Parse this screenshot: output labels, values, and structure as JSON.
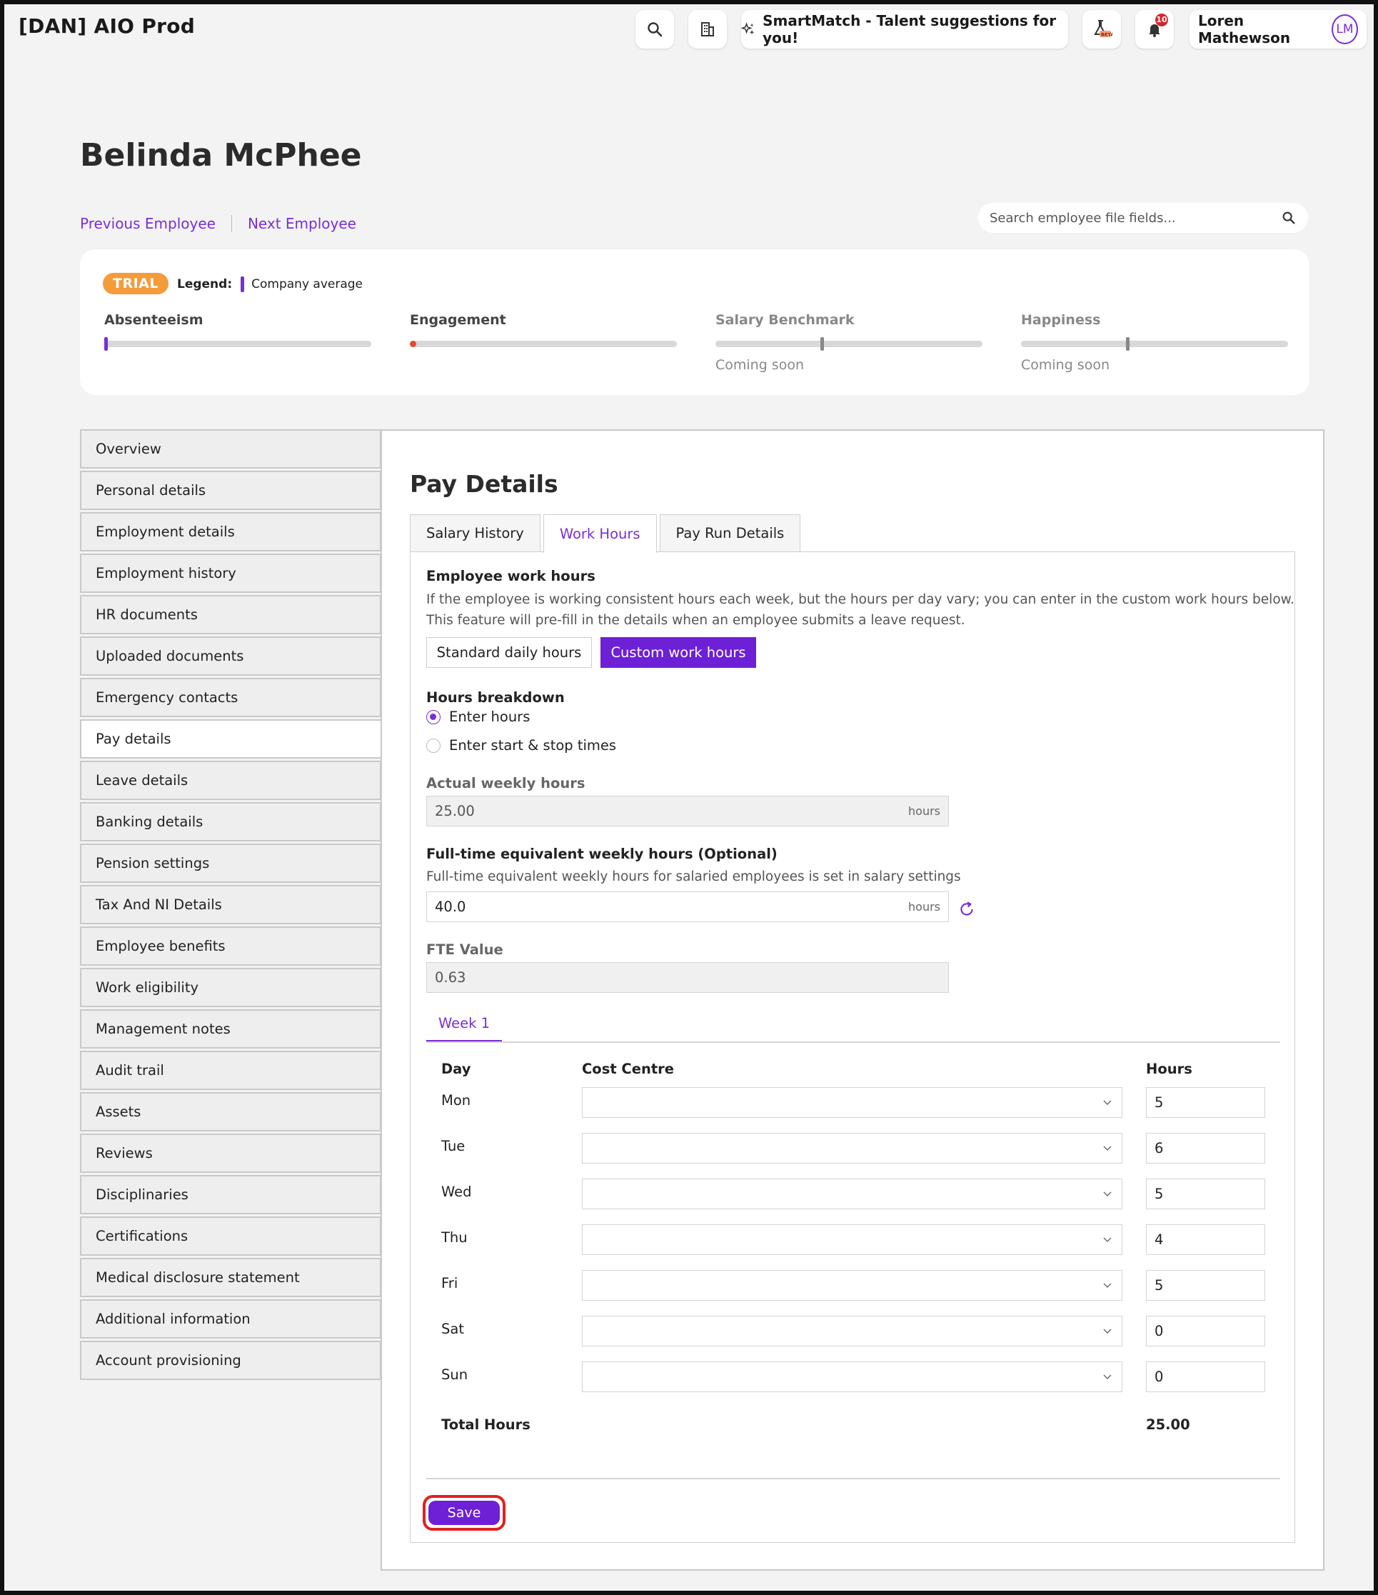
{
  "app": {
    "title": "[DAN] AIO Prod",
    "smartmatch_label": "SmartMatch - Talent suggestions for you!",
    "notifications_count": "10",
    "user_name": "Loren Mathewson",
    "user_initials": "LM"
  },
  "employee": {
    "name": "Belinda McPhee",
    "prev_label": "Previous Employee",
    "next_label": "Next Employee",
    "search_placeholder": "Search employee file fields..."
  },
  "metrics": {
    "trial_label": "TRIAL",
    "legend_label": "Legend:",
    "legend_item": "Company average",
    "items": [
      {
        "label": "Absenteeism",
        "note": ""
      },
      {
        "label": "Engagement",
        "note": ""
      },
      {
        "label": "Salary Benchmark",
        "note": "Coming soon"
      },
      {
        "label": "Happiness",
        "note": "Coming soon"
      }
    ]
  },
  "sidebar": {
    "items": [
      "Overview",
      "Personal details",
      "Employment details",
      "Employment history",
      "HR documents",
      "Uploaded documents",
      "Emergency contacts",
      "Pay details",
      "Leave details",
      "Banking details",
      "Pension settings",
      "Tax And NI Details",
      "Employee benefits",
      "Work eligibility",
      "Management notes",
      "Audit trail",
      "Assets",
      "Reviews",
      "Disciplinaries",
      "Certifications",
      "Medical disclosure statement",
      "Additional information",
      "Account provisioning"
    ],
    "active": "Pay details"
  },
  "pay": {
    "title": "Pay Details",
    "tabs": [
      "Salary History",
      "Work Hours",
      "Pay Run Details"
    ],
    "active_tab": "Work Hours",
    "work_hours_title": "Employee work hours",
    "work_hours_help_1": "If the employee is working consistent hours each week, but the hours per day vary; you can enter in the custom work hours below.",
    "work_hours_help_2": "This feature will pre-fill in the details when an employee submits a leave request.",
    "standard_label": "Standard daily hours",
    "custom_label": "Custom work hours",
    "breakdown_title": "Hours breakdown",
    "radio_enter_hours": "Enter hours",
    "radio_start_stop": "Enter start & stop times",
    "actual_weekly_title": "Actual weekly hours",
    "actual_weekly_value": "25.00",
    "unit_hours": "hours",
    "fte_weekly_title": "Full-time equivalent weekly hours (Optional)",
    "fte_weekly_help": "Full-time equivalent weekly hours for salaried employees is set in salary settings",
    "fte_weekly_value": "40.0",
    "fte_value_title": "FTE Value",
    "fte_value": "0.63",
    "week_tab": "Week 1",
    "col_day": "Day",
    "col_cost": "Cost Centre",
    "col_hours": "Hours",
    "rows": [
      {
        "day": "Mon",
        "hours": "5"
      },
      {
        "day": "Tue",
        "hours": "6"
      },
      {
        "day": "Wed",
        "hours": "5"
      },
      {
        "day": "Thu",
        "hours": "4"
      },
      {
        "day": "Fri",
        "hours": "5"
      },
      {
        "day": "Sat",
        "hours": "0"
      },
      {
        "day": "Sun",
        "hours": "0"
      }
    ],
    "total_label": "Total Hours",
    "total_value": "25.00",
    "save_label": "Save"
  },
  "colors": {
    "accent": "#7a2ed8",
    "button": "#6d20d6",
    "trial": "#f59b3a",
    "highlight": "#e0211f"
  }
}
